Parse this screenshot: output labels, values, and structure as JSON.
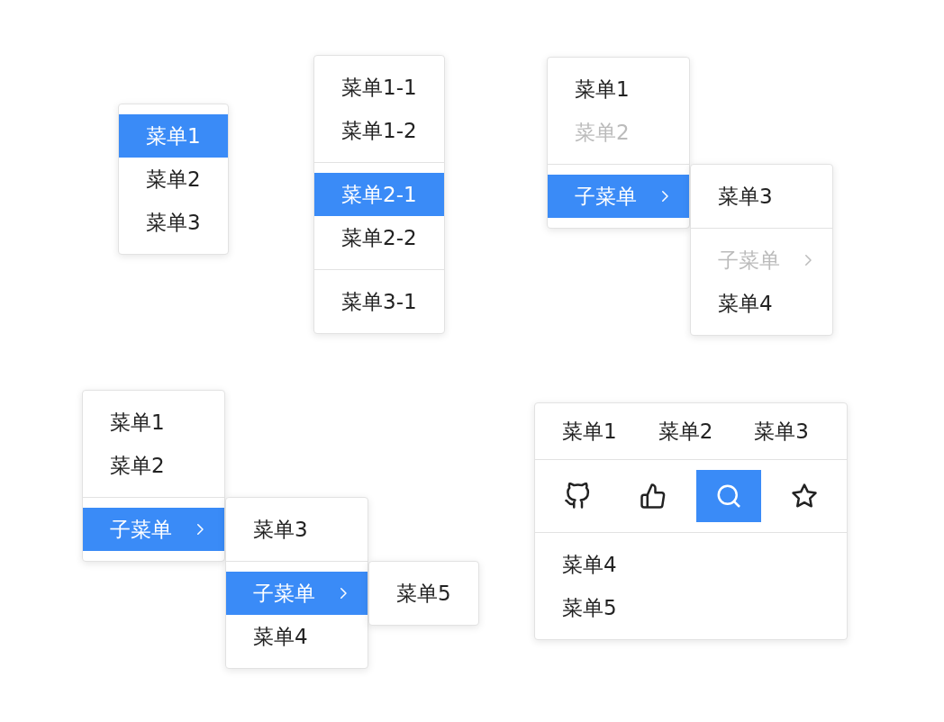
{
  "menus": [
    {
      "groups": [
        {
          "kind": "list",
          "items": [
            {
              "kind": "item",
              "label": "菜单1",
              "selected": true,
              "disabled": false
            },
            {
              "kind": "item",
              "label": "菜单2",
              "selected": false,
              "disabled": false
            },
            {
              "kind": "item",
              "label": "菜单3",
              "selected": false,
              "disabled": false
            }
          ]
        }
      ]
    },
    {
      "groups": [
        {
          "kind": "list",
          "items": [
            {
              "kind": "item",
              "label": "菜单1-1",
              "selected": false,
              "disabled": false
            },
            {
              "kind": "item",
              "label": "菜单1-2",
              "selected": false,
              "disabled": false
            }
          ]
        },
        {
          "kind": "list",
          "items": [
            {
              "kind": "item",
              "label": "菜单2-1",
              "selected": true,
              "disabled": false
            },
            {
              "kind": "item",
              "label": "菜单2-2",
              "selected": false,
              "disabled": false
            }
          ]
        },
        {
          "kind": "list",
          "items": [
            {
              "kind": "item",
              "label": "菜单3-1",
              "selected": false,
              "disabled": false
            }
          ]
        }
      ]
    },
    {
      "groups": [
        {
          "kind": "list",
          "items": [
            {
              "kind": "item",
              "label": "菜单1",
              "selected": false,
              "disabled": false
            },
            {
              "kind": "item",
              "label": "菜单2",
              "selected": false,
              "disabled": true
            }
          ]
        },
        {
          "kind": "list",
          "items": [
            {
              "kind": "submenu",
              "label": "子菜单",
              "selected": true,
              "disabled": false,
              "children": [
                {
                  "kind": "list",
                  "items": [
                    {
                      "kind": "item",
                      "label": "菜单3",
                      "selected": false,
                      "disabled": false
                    }
                  ]
                },
                {
                  "kind": "list",
                  "items": [
                    {
                      "kind": "submenu",
                      "label": "子菜单",
                      "selected": false,
                      "disabled": true
                    },
                    {
                      "kind": "item",
                      "label": "菜单4",
                      "selected": false,
                      "disabled": false
                    }
                  ]
                }
              ]
            }
          ]
        }
      ]
    },
    {
      "groups": [
        {
          "kind": "list",
          "items": [
            {
              "kind": "item",
              "label": "菜单1",
              "selected": false,
              "disabled": false
            },
            {
              "kind": "item",
              "label": "菜单2",
              "selected": false,
              "disabled": false
            }
          ]
        },
        {
          "kind": "list",
          "items": [
            {
              "kind": "submenu",
              "label": "子菜单",
              "selected": true,
              "disabled": false,
              "children": [
                {
                  "kind": "list",
                  "items": [
                    {
                      "kind": "item",
                      "label": "菜单3",
                      "selected": false,
                      "disabled": false
                    }
                  ]
                },
                {
                  "kind": "list",
                  "items": [
                    {
                      "kind": "submenu",
                      "label": "子菜单",
                      "selected": true,
                      "disabled": false,
                      "children": [
                        {
                          "kind": "list",
                          "items": [
                            {
                              "kind": "item",
                              "label": "菜单5",
                              "selected": false,
                              "disabled": false
                            }
                          ]
                        }
                      ]
                    },
                    {
                      "kind": "item",
                      "label": "菜单4",
                      "selected": false,
                      "disabled": false
                    }
                  ]
                }
              ]
            }
          ]
        }
      ]
    },
    {
      "groups": [
        {
          "kind": "row",
          "items": [
            {
              "kind": "item",
              "label": "菜单1",
              "selected": false,
              "disabled": false
            },
            {
              "kind": "item",
              "label": "菜单2",
              "selected": false,
              "disabled": false
            },
            {
              "kind": "item",
              "label": "菜单3",
              "selected": false,
              "disabled": false
            }
          ]
        },
        {
          "kind": "icons",
          "items": [
            {
              "kind": "icon",
              "selected": false,
              "disabled": false
            },
            {
              "kind": "icon",
              "selected": false,
              "disabled": false
            },
            {
              "kind": "icon",
              "selected": true,
              "disabled": false
            },
            {
              "kind": "icon",
              "selected": false,
              "disabled": false
            }
          ]
        },
        {
          "kind": "list",
          "items": [
            {
              "kind": "item",
              "label": "菜单4",
              "selected": false,
              "disabled": false
            },
            {
              "kind": "item",
              "label": "菜单5",
              "selected": false,
              "disabled": false
            }
          ]
        }
      ]
    }
  ]
}
